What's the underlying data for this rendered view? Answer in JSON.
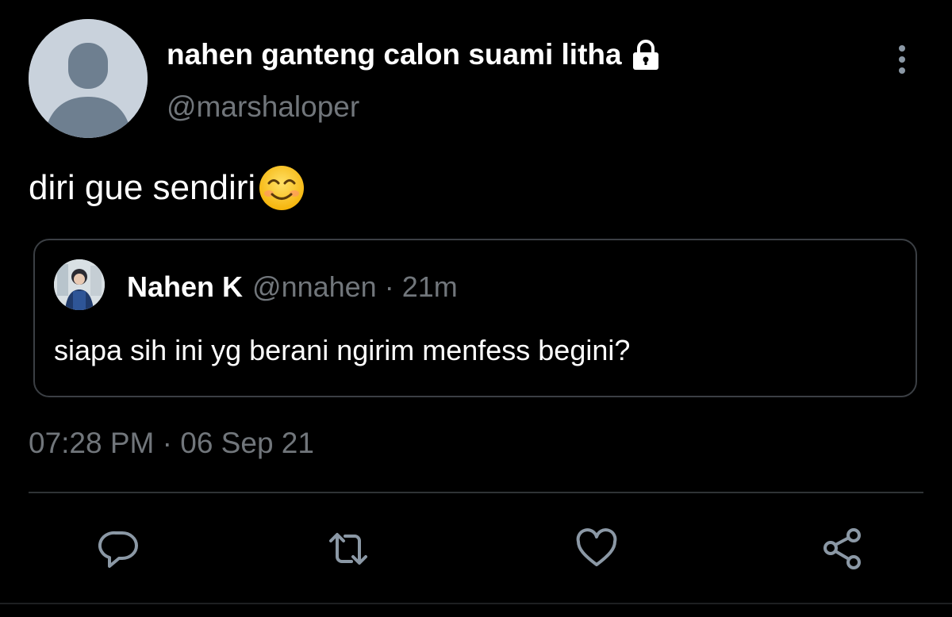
{
  "tweet": {
    "author": {
      "display_name": "nahen ganteng calon suami litha",
      "handle": "@marshaloper",
      "protected_icon": "lock-icon",
      "avatar": "default-avatar"
    },
    "menu_icon": "more-vertical-icon",
    "text": "diri gue sendiri",
    "emoji": "smiling-face-with-smiling-eyes",
    "timestamp": "07:28 PM · 06 Sep 21"
  },
  "quoted_tweet": {
    "display_name": "Nahen K",
    "meta": "@nnahen · 21m",
    "text": "siapa sih ini yg berani ngirim menfess begini?"
  },
  "actions": [
    {
      "name": "reply",
      "icon": "reply-icon"
    },
    {
      "name": "retweet",
      "icon": "retweet-icon"
    },
    {
      "name": "like",
      "icon": "heart-icon"
    },
    {
      "name": "share",
      "icon": "share-icon"
    }
  ],
  "colors": {
    "background": "#000000",
    "primary_text": "#ffffff",
    "secondary_text": "#71767b",
    "border": "#3b3f44",
    "icon": "#8b98a5"
  }
}
